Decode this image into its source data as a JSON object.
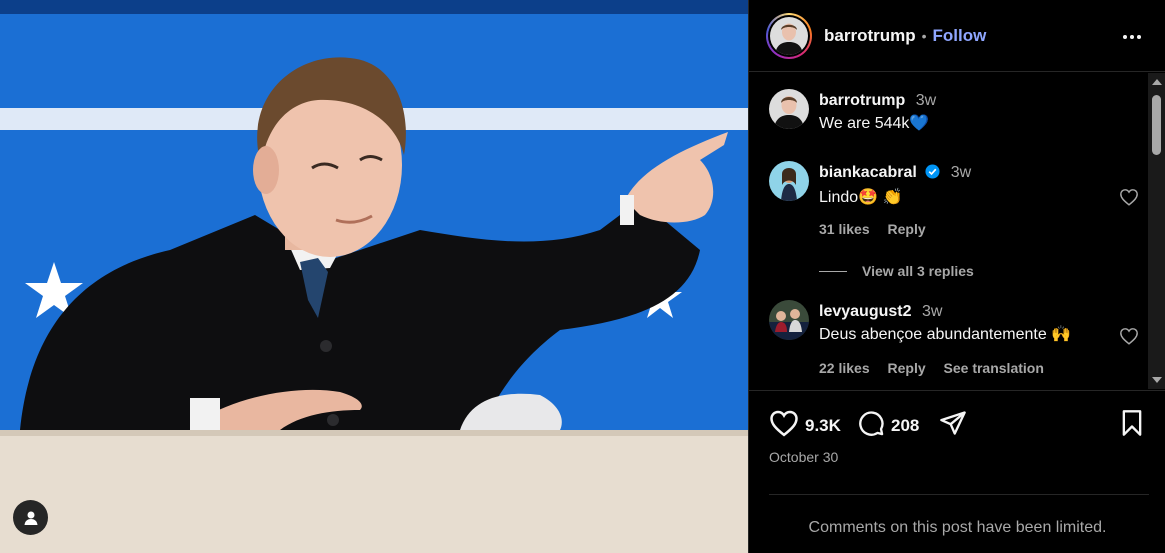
{
  "post": {
    "author": "barrotrump",
    "separator": "•",
    "follow_label": "Follow",
    "media_alt_icon": "user-tag-icon"
  },
  "comments": [
    {
      "username": "barrotrump",
      "time": "3w",
      "text": "We are 544k",
      "emoji": "💙",
      "verified": false
    },
    {
      "username": "biankacabral",
      "time": "3w",
      "text": "Lindo",
      "emoji": "🤩 👏",
      "verified": true,
      "likes": "31 likes",
      "reply": "Reply",
      "view_replies": "View all 3 replies"
    },
    {
      "username": "levyaugust2",
      "time": "3w",
      "text": "Deus abençoe abundantemente",
      "emoji": "🙌",
      "verified": false,
      "likes": "22 likes",
      "reply": "Reply",
      "translation": "See translation"
    }
  ],
  "actions": {
    "like_count": "9.3K",
    "comment_count": "208",
    "date": "October 30"
  },
  "footer": {
    "limited_text": "Comments on this post have been limited."
  },
  "colors": {
    "background": "#000000",
    "follow": "#8fa6ff",
    "verified": "#0095f6",
    "secondary_text": "#a8a8a8",
    "backdrop_blue": "#1b6fd4"
  }
}
